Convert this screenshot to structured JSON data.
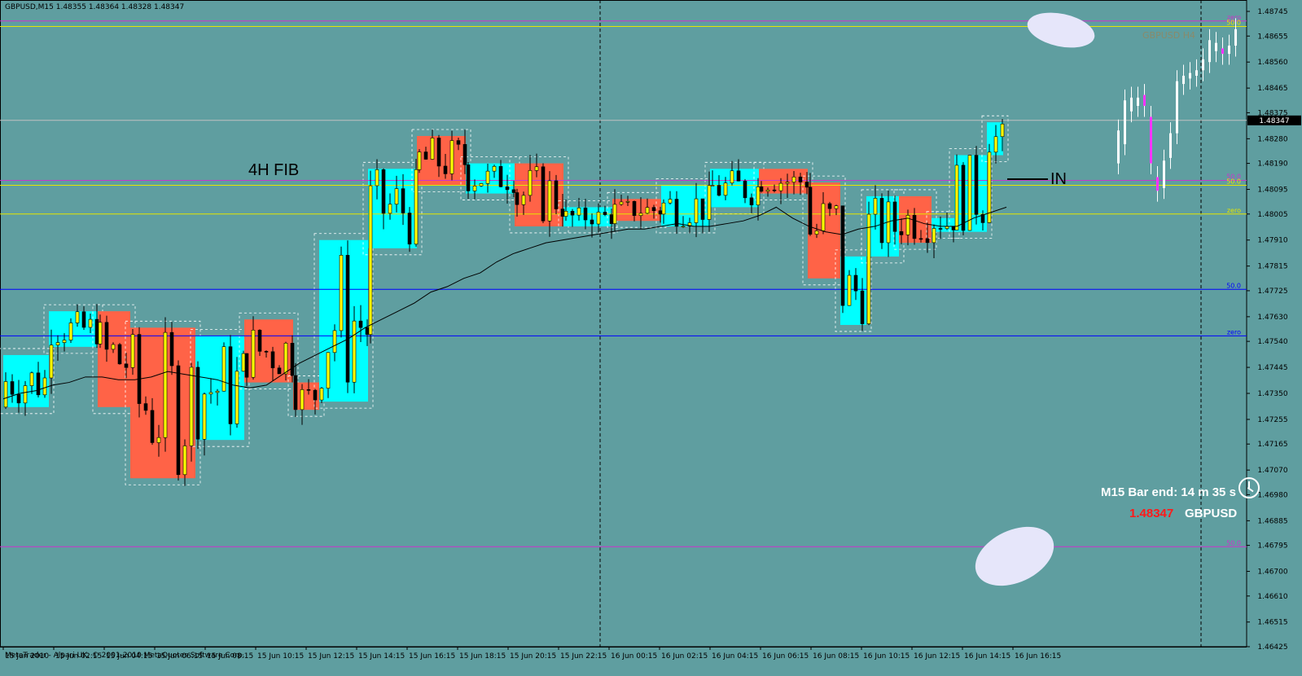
{
  "window": {
    "title": "GBPUSD,M15  1.48355 1.48364 1.48328 1.48347",
    "copyright": "MetaTrader - Alpari UK, © 2001-2010 MetaQuotes Software Corp."
  },
  "annotations": {
    "fib_label": "4H FIB",
    "entry_label": "IN",
    "h4_label": "GBPUSD  H4",
    "timer": "M15 Bar end: 14 m 35 s",
    "bid": "1.48347",
    "symbol": "GBPUSD"
  },
  "colors": {
    "background": "#5f9ea0",
    "bull_box": "#00ffff",
    "bear_box": "#ff6347",
    "bull_candle": "#ffff00",
    "bear_candle": "#000000",
    "ma_line": "#000000",
    "fib_magenta": "#cc33cc",
    "fib_yellow": "#e6e600",
    "fib_blue": "#0000ff",
    "price_line": "#c0c0c0"
  },
  "chart_data": {
    "type": "candlestick",
    "y_ticks": [
      "1.48745",
      "1.48655",
      "1.48560",
      "1.48465",
      "1.48375",
      "1.48280",
      "1.48190",
      "1.48095",
      "1.48005",
      "1.47910",
      "1.47815",
      "1.47725",
      "1.47630",
      "1.47540",
      "1.47445",
      "1.47350",
      "1.47255",
      "1.47165",
      "1.47070",
      "1.46980",
      "1.46885",
      "1.46795",
      "1.46700",
      "1.46610",
      "1.46515",
      "1.46425"
    ],
    "x_ticks": [
      "15 Jun 2010",
      "15 Jun 02:15",
      "15 Jun 04:15",
      "15 Jun 06:15",
      "15 Jun 08:15",
      "15 Jun 10:15",
      "15 Jun 12:15",
      "15 Jun 14:15",
      "15 Jun 16:15",
      "15 Jun 18:15",
      "15 Jun 20:15",
      "15 Jun 22:15",
      "16 Jun 00:15",
      "16 Jun 02:15",
      "16 Jun 04:15",
      "16 Jun 06:15",
      "16 Jun 08:15",
      "16 Jun 10:15",
      "16 Jun 12:15",
      "16 Jun 14:15",
      "16 Jun 16:15"
    ],
    "current_price": "1.48347",
    "ylim": [
      1.46425,
      1.48745
    ],
    "fib_levels": [
      {
        "price": 1.4871,
        "label": "zero",
        "color": "#cc33cc"
      },
      {
        "price": 1.4869,
        "label": "50.0",
        "color": "#e6e600"
      },
      {
        "price": 1.48128,
        "label": "50.0",
        "color": "#cc33cc"
      },
      {
        "price": 1.4811,
        "label": "50.0",
        "color": "#e6e600"
      },
      {
        "price": 1.48005,
        "label": "zero",
        "color": "#e6e600"
      },
      {
        "price": 1.4773,
        "label": "50.0",
        "color": "#0000ff"
      },
      {
        "price": 1.4756,
        "label": "zero",
        "color": "#0000ff"
      },
      {
        "price": 1.4679,
        "label": "50.0",
        "color": "#cc33cc"
      }
    ],
    "boxes": [
      {
        "t0": 0,
        "t1": 14,
        "top": 1.4749,
        "bot": 1.473,
        "color": "bull"
      },
      {
        "t0": 14,
        "t1": 29,
        "top": 1.4765,
        "bot": 1.4752,
        "color": "bull"
      },
      {
        "t0": 29,
        "t1": 39,
        "top": 1.4765,
        "bot": 1.473,
        "color": "bear"
      },
      {
        "t0": 39,
        "t1": 59,
        "top": 1.4759,
        "bot": 1.4704,
        "color": "bear"
      },
      {
        "t0": 59,
        "t1": 74,
        "top": 1.4756,
        "bot": 1.4718,
        "color": "bull"
      },
      {
        "t0": 74,
        "t1": 89,
        "top": 1.4762,
        "bot": 1.4739,
        "color": "bear"
      },
      {
        "t0": 89,
        "t1": 97,
        "top": 1.4739,
        "bot": 1.4729,
        "color": "bear"
      },
      {
        "t0": 97,
        "t1": 112,
        "top": 1.4791,
        "bot": 1.4732,
        "color": "bull"
      },
      {
        "t0": 112,
        "t1": 127,
        "top": 1.4817,
        "bot": 1.4788,
        "color": "bull"
      },
      {
        "t0": 127,
        "t1": 142,
        "top": 1.4829,
        "bot": 1.4811,
        "color": "bear"
      },
      {
        "t0": 142,
        "t1": 157,
        "top": 1.4819,
        "bot": 1.4808,
        "color": "bull"
      },
      {
        "t0": 157,
        "t1": 172,
        "top": 1.4819,
        "bot": 1.4796,
        "color": "bear"
      },
      {
        "t0": 172,
        "t1": 187,
        "top": 1.4803,
        "bot": 1.4796,
        "color": "bull"
      },
      {
        "t0": 187,
        "t1": 202,
        "top": 1.4806,
        "bot": 1.4798,
        "color": "bear"
      },
      {
        "t0": 202,
        "t1": 217,
        "top": 1.4811,
        "bot": 1.4796,
        "color": "bull"
      },
      {
        "t0": 217,
        "t1": 232,
        "top": 1.4817,
        "bot": 1.4803,
        "color": "bull"
      },
      {
        "t0": 232,
        "t1": 247,
        "top": 1.4817,
        "bot": 1.4808,
        "color": "bear"
      },
      {
        "t0": 247,
        "t1": 257,
        "top": 1.4812,
        "bot": 1.4777,
        "color": "bear"
      },
      {
        "t0": 257,
        "t1": 265,
        "top": 1.4785,
        "bot": 1.476,
        "color": "bull"
      },
      {
        "t0": 265,
        "t1": 275,
        "top": 1.4807,
        "bot": 1.4785,
        "color": "bull"
      },
      {
        "t0": 275,
        "t1": 285,
        "top": 1.4807,
        "bot": 1.479,
        "color": "bear"
      },
      {
        "t0": 285,
        "t1": 292,
        "top": 1.4799,
        "bot": 1.4794,
        "color": "bull"
      },
      {
        "t0": 292,
        "t1": 302,
        "top": 1.4822,
        "bot": 1.4794,
        "color": "bull"
      },
      {
        "t0": 302,
        "t1": 307,
        "top": 1.4834,
        "bot": 1.4822,
        "color": "bull"
      }
    ],
    "candles": [],
    "ma": [
      1.4733,
      1.4735,
      1.4736,
      1.4738,
      1.4739,
      1.4741,
      1.4741,
      1.474,
      1.474,
      1.4741,
      1.4743,
      1.4742,
      1.4741,
      1.474,
      1.4738,
      1.4737,
      1.4738,
      1.4742,
      1.4746,
      1.4749,
      1.4752,
      1.4755,
      1.4759,
      1.4762,
      1.4765,
      1.4768,
      1.4772,
      1.4774,
      1.4777,
      1.4779,
      1.4783,
      1.4786,
      1.4788,
      1.479,
      1.4791,
      1.4792,
      1.4793,
      1.4794,
      1.4795,
      1.4795,
      1.4796,
      1.4797,
      1.4796,
      1.4796,
      1.4797,
      1.4798,
      1.48,
      1.4803,
      1.4799,
      1.4796,
      1.4794,
      1.4793,
      1.4795,
      1.4796,
      1.4798,
      1.4799,
      1.4797,
      1.4796,
      1.4796,
      1.4799,
      1.4801,
      1.4803
    ]
  }
}
